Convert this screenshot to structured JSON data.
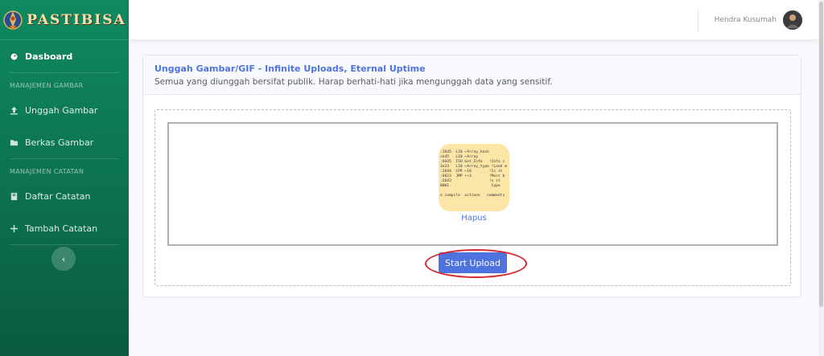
{
  "brand": {
    "name": "PASTIBISA"
  },
  "sidebar": {
    "dashboard": "Dasboard",
    "heading_gambar": "MANAJEMEN GAMBAR",
    "items_gambar": [
      {
        "label": "Unggah Gambar",
        "icon": "upload-icon"
      },
      {
        "label": "Berkas Gambar",
        "icon": "folder-icon"
      }
    ],
    "heading_catatan": "MANAJEMEN CATATAN",
    "items_catatan": [
      {
        "label": "Daftar Catatan",
        "icon": "book-icon"
      },
      {
        "label": "Tambah Catatan",
        "icon": "plus-icon"
      }
    ],
    "toggle_icon": "chevron-left-icon"
  },
  "topbar": {
    "user_name": "Hendra Kusumah"
  },
  "card": {
    "title": "Unggah Gambar/GIF - Infinite Uploads, Eternal Uptime",
    "subtitle": "Semua yang diunggah bersifat publik. Harap berhati-hati jika mengunggah data yang sensitif."
  },
  "upload": {
    "remove_label": "Hapus",
    "start_label": "Start Upload"
  },
  "colors": {
    "primary": "#4e73df",
    "sidebar": "#0c6e4f",
    "annotation": "#d9262e"
  }
}
